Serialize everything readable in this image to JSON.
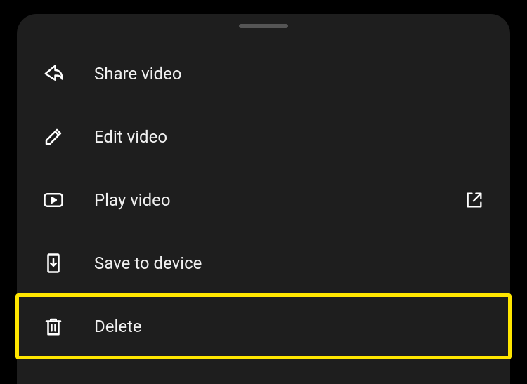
{
  "menu": {
    "items": [
      {
        "label": "Share video"
      },
      {
        "label": "Edit video"
      },
      {
        "label": "Play video"
      },
      {
        "label": "Save to device"
      },
      {
        "label": "Delete"
      }
    ]
  },
  "highlight_color": "#ffe600"
}
